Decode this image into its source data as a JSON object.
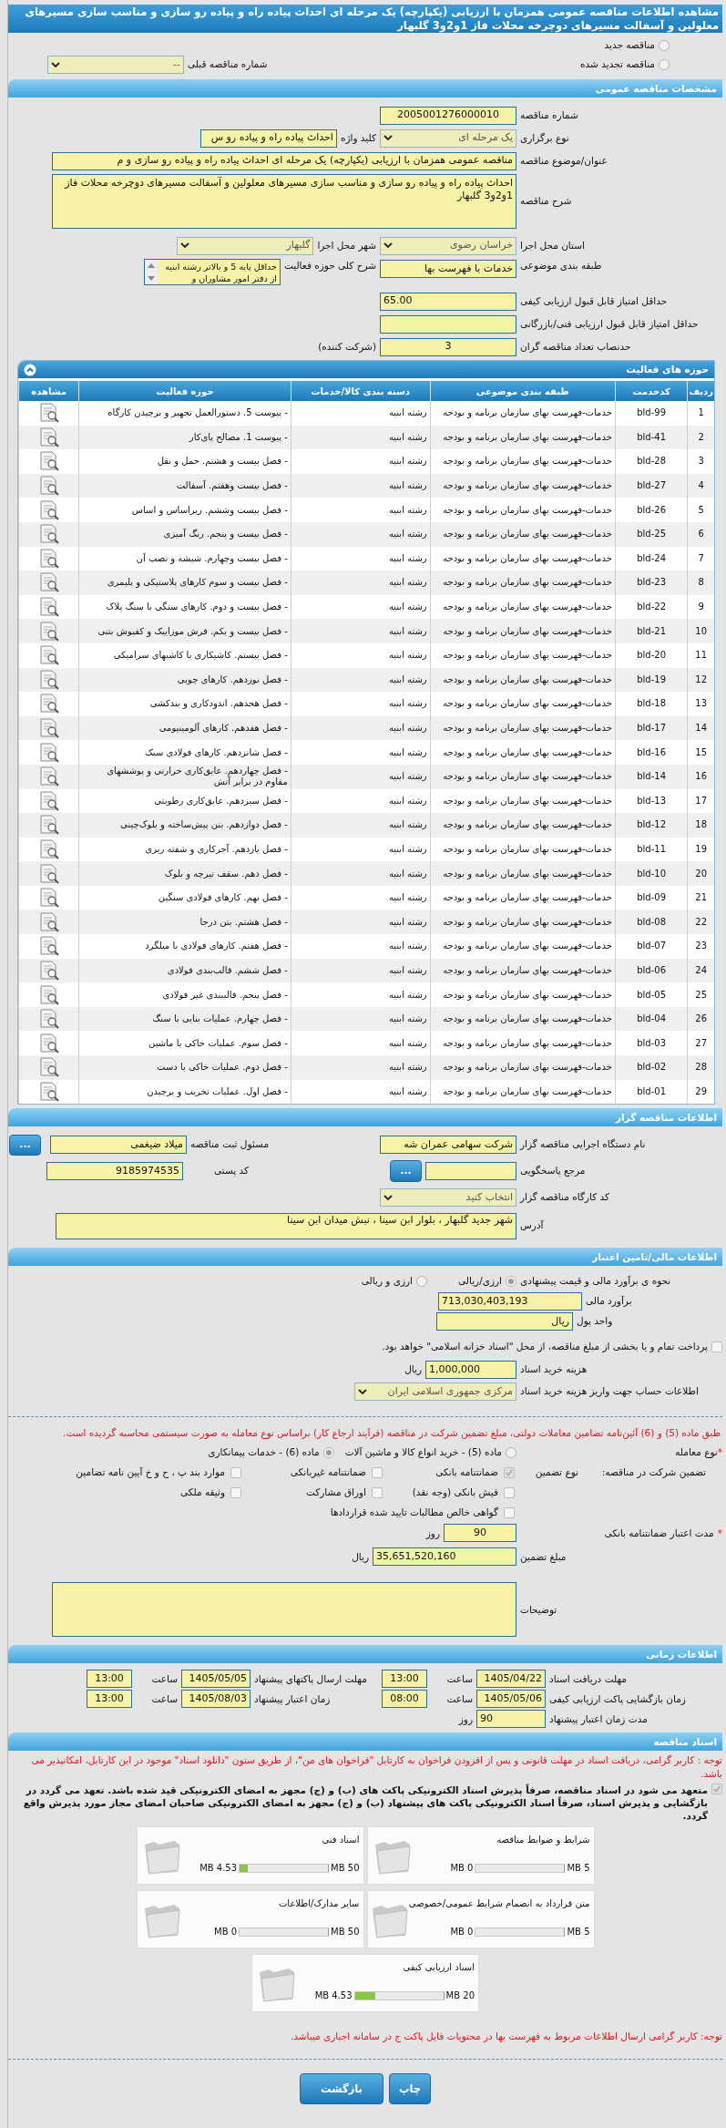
{
  "title": "مشاهده اطلاعات مناقصه عمومی همزمان با ارزیابی (یکپارچه) یک مرحله ای احداث پیاده راه و پیاده رو سازی و مناسب سازی مسیرهای معلولین و آسفالت مسیرهای دوچرخه محلات فاز 1و2و3 گلبهار",
  "tender_kind": [
    {
      "label": "مناقصه جدید",
      "selected": false
    },
    {
      "label": "مناقصه تجدید شده",
      "selected": false
    }
  ],
  "previous_tender": {
    "label": "شماره مناقصه قبلی",
    "value": "--"
  },
  "general": {
    "heading": "مشخصات مناقصه عمومی",
    "number": {
      "label": "شماره مناقصه",
      "value": "2005001276000010"
    },
    "holding_type": {
      "label": "نوع برگزاری",
      "value": "یک مرحله ای"
    },
    "keyword": {
      "label": "کلید واژه",
      "value": "احداث پیاده راه و پیاده رو س"
    },
    "subject": {
      "label": "عنوان/موضوع مناقصه",
      "value": "مناقصه عمومی همزمان با ارزیابی (یکپارچه) یک مرحله ای احداث پیاده راه و پیاده رو سازی و م"
    },
    "description": {
      "label": "شرح مناقصه",
      "value": "احداث پیاده راه و پیاده رو سازی و مناسب سازی مسیرهای معلولین و آسفالت مسیرهای دوچرخه محلات فاز 1و2و3 گلبهار"
    },
    "province": {
      "label": "استان محل اجرا",
      "value": "خراسان رضوی"
    },
    "city": {
      "label": "شهر محل اجرا",
      "value": "گلبهار"
    },
    "category": {
      "label": "طبقه بندی موضوعی",
      "value": "خدمات با فهرست بها"
    },
    "activity_scope": {
      "label": "شرح کلی حوزه فعالیت",
      "value": "حداقل پایه 5 و بالاتر رشته ابنیه از دفتر امور مشاوران و"
    },
    "min_quality_score": {
      "label": "حداقل امتیاز قابل قبول ارزیابی کیفی",
      "value": "65.00"
    },
    "min_technical_score": {
      "label": "حداقل امتیاز قابل قبول ارزیابی فنی/بازرگانی"
    },
    "quorum": {
      "label": "حدنصاب تعداد مناقصه گران",
      "value": "3",
      "suffix": "(شرکت کننده)"
    }
  },
  "activities": {
    "heading": "حوزه های فعالیت",
    "columns": [
      "ردیف",
      "کدخدمت",
      "طبقه بندی موضوعی",
      "دسته بندی کالا/خدمات",
      "حوزه فعالیت",
      "مشاهده"
    ],
    "rows": [
      {
        "cells": [
          "1",
          "bld-99",
          "خدمات-فهرست بهای سازمان برنامه و بودجه",
          "رشته ابنیه",
          "- پیوست 5. دستورالعمل تجهیز و برچیدن کارگاه"
        ]
      },
      {
        "cells": [
          "2",
          "bld-41",
          "خدمات-فهرست بهای سازمان برنامه و بودجه",
          "رشته ابنیه",
          "- پیوست 1. مصالح پای‌کار"
        ]
      },
      {
        "cells": [
          "3",
          "bld-28",
          "خدمات-فهرست بهای سازمان برنامه و بودجه",
          "رشته ابنیه",
          "- فصل بیست و هشتم. حمل و نقل"
        ]
      },
      {
        "cells": [
          "4",
          "bld-27",
          "خدمات-فهرست بهای سازمان برنامه و بودجه",
          "رشته ابنیه",
          "- فصل بیست وهفتم. آسفالت"
        ]
      },
      {
        "cells": [
          "5",
          "bld-26",
          "خدمات-فهرست بهای سازمان برنامه و بودجه",
          "رشته ابنیه",
          "- فصل بیست وششم. زیراساس و اساس"
        ]
      },
      {
        "cells": [
          "6",
          "bld-25",
          "خدمات-فهرست بهای سازمان برنامه و بودجه",
          "رشته ابنیه",
          "- فصل بیست و پنجم. رنگ آمیزی"
        ]
      },
      {
        "cells": [
          "7",
          "bld-24",
          "خدمات-فهرست بهای سازمان برنامه و بودجه",
          "رشته ابنیه",
          "- فصل بیست وچهارم. شیشه و نصب آن"
        ]
      },
      {
        "cells": [
          "8",
          "bld-23",
          "خدمات-فهرست بهای سازمان برنامه و بودجه",
          "رشته ابنیه",
          "- فصل بیست و سوم کارهای پلاستیکی و پلیمری"
        ]
      },
      {
        "cells": [
          "9",
          "bld-22",
          "خدمات-فهرست بهای سازمان برنامه و بودجه",
          "رشته ابنیه",
          "- فصل بیست و دوم. کارهای سنگی با سنگ پلاک"
        ]
      },
      {
        "cells": [
          "10",
          "bld-21",
          "خدمات-فهرست بهای سازمان برنامه و بودجه",
          "رشته ابنیه",
          "- فصل بیست و یکم. فرش موزاییک و کفپوش بتنی"
        ]
      },
      {
        "cells": [
          "11",
          "bld-20",
          "خدمات-فهرست بهای سازمان برنامه و بودجه",
          "رشته ابنیه",
          "- فصل بیستم. کاشیکاری با کاشیهای سرامیکی"
        ]
      },
      {
        "cells": [
          "12",
          "bld-19",
          "خدمات-فهرست بهای سازمان برنامه و بودجه",
          "رشته ابنیه",
          "- فصل نوزدهم. کارهای چوبی"
        ]
      },
      {
        "cells": [
          "13",
          "bld-18",
          "خدمات-فهرست بهای سازمان برنامه و بودجه",
          "رشته ابنیه",
          "- فصل هجدهم. اندودکاری و بندکشی"
        ]
      },
      {
        "cells": [
          "14",
          "bld-17",
          "خدمات-فهرست بهای سازمان برنامه و بودجه",
          "رشته ابنیه",
          "- فصل هفدهم. کارهای آلومینیومی"
        ]
      },
      {
        "cells": [
          "15",
          "bld-16",
          "خدمات-فهرست بهای سازمان برنامه و بودجه",
          "رشته ابنیه",
          "- فصل شانزدهم. کارهای فولادی سبک"
        ]
      },
      {
        "cells": [
          "16",
          "bld-14",
          "خدمات-فهرست بهای سازمان برنامه و بودجه",
          "رشته ابنیه",
          "- فصل چهاردهم. عایق‌کاری حرارتی و پوششهای مقاوم در برابر آتش"
        ]
      },
      {
        "cells": [
          "17",
          "bld-13",
          "خدمات-فهرست بهای سازمان برنامه و بودجه",
          "رشته ابنیه",
          "- فصل سیزدهم. عایق‌کاری رطوبتی"
        ]
      },
      {
        "cells": [
          "18",
          "bld-12",
          "خدمات-فهرست بهای سازمان برنامه و بودجه",
          "رشته ابنیه",
          "- فصل دوازدهم. بتن پیش‌ساخته و بلوک‌چینی"
        ]
      },
      {
        "cells": [
          "19",
          "bld-11",
          "خدمات-فهرست بهای سازمان برنامه و بودجه",
          "رشته ابنیه",
          "- فصل یازدهم. آجرکاری و شفته ریزی"
        ]
      },
      {
        "cells": [
          "20",
          "bld-10",
          "خدمات-فهرست بهای سازمان برنامه و بودجه",
          "رشته ابنیه",
          "- فصل دهم. سقف تیرچه و بلوک"
        ]
      },
      {
        "cells": [
          "21",
          "bld-09",
          "خدمات-فهرست بهای سازمان برنامه و بودجه",
          "رشته ابنیه",
          "- فصل نهم. کارهای فولادی سنگین"
        ]
      },
      {
        "cells": [
          "22",
          "bld-08",
          "خدمات-فهرست بهای سازمان برنامه و بودجه",
          "رشته ابنیه",
          "- فصل هشتم. بتن درجا"
        ]
      },
      {
        "cells": [
          "23",
          "bld-07",
          "خدمات-فهرست بهای سازمان برنامه و بودجه",
          "رشته ابنیه",
          "- فصل هفتم. کارهای فولادی با میلگرد"
        ]
      },
      {
        "cells": [
          "24",
          "bld-06",
          "خدمات-فهرست بهای سازمان برنامه و بودجه",
          "رشته ابنیه",
          "- فصل ششم. قالب‌بندی فولادی"
        ]
      },
      {
        "cells": [
          "25",
          "bld-05",
          "خدمات-فهرست بهای سازمان برنامه و بودجه",
          "رشته ابنیه",
          "- فصل پنجم. قالببندی غیر فولادی"
        ]
      },
      {
        "cells": [
          "26",
          "bld-04",
          "خدمات-فهرست بهای سازمان برنامه و بودجه",
          "رشته ابنیه",
          "- فصل چهارم. عملیات بنایی با سنگ"
        ]
      },
      {
        "cells": [
          "27",
          "bld-03",
          "خدمات-فهرست بهای سازمان برنامه و بودجه",
          "رشته ابنیه",
          "- فصل سوم. عملیات خاکی با ماشین"
        ]
      },
      {
        "cells": [
          "28",
          "bld-02",
          "خدمات-فهرست بهای سازمان برنامه و بودجه",
          "رشته ابنیه",
          "- فصل دوم. عملیات خاکی با دست"
        ]
      },
      {
        "cells": [
          "29",
          "bld-01",
          "خدمات-فهرست بهای سازمان برنامه و بودجه",
          "رشته ابنیه",
          "- فصل اول. عملیات تخریب و برچیدن"
        ]
      }
    ]
  },
  "organizer": {
    "heading": "اطلاعات مناقصه گزار",
    "agency": {
      "label": "نام دستگاه اجرایی مناقصه گزار",
      "value": "شرکت سهامی عمران شه"
    },
    "registrar": {
      "label": "مسئول ثبت مناقصه",
      "value": "میلاد ضیغمی",
      "button": "..."
    },
    "reference": {
      "label": "مرجع پاسخگویی",
      "button": "..."
    },
    "postal_code": {
      "label": "کد پستی",
      "value": "9185974535"
    },
    "workshop_code": {
      "label": "کد کارگاه مناقصه گزار",
      "value": "انتخاب کنید"
    },
    "address": {
      "label": "آدرس",
      "value": "شهر جدید گلبهار ، بلوار ابن سینا ، نبش میدان ابن سینا"
    }
  },
  "financial": {
    "heading": "اطلاعات مالی/تامین اعتبار",
    "estimate_method": {
      "label": "نحوه ی برآورد مالی و قیمت پیشنهادی",
      "options": [
        {
          "label": "ارزی/ریالی",
          "selected": true
        },
        {
          "label": "ارزی و ریالی",
          "selected": false
        }
      ]
    },
    "estimate": {
      "label": "برآورد مالی",
      "value": "713,030,403,193"
    },
    "currency": {
      "label": "واحد پول",
      "value": "ریال"
    },
    "treasury_bonds": {
      "label": "پرداخت تمام و یا بخشی از مبلغ مناقصه، از محل \"اسناد خزانه اسلامی\" خواهد بود.",
      "checked": false
    },
    "document_fee": {
      "label": "هزینه خرید اسناد",
      "value": "1,000,000",
      "unit": "ریال"
    },
    "account": {
      "label": "اطلاعات حساب جهت واریز هزینه خرید اسناد",
      "value": "مرکزی جمهوری اسلامی ایران"
    },
    "notice": "طبق ماده (5) و (6) آئین‌نامه تضامین معاملات دولتی، مبلغ تضمین شرکت در مناقصه (فرآیند ارجاع کار) براساس نوع معامله به صورت سیستمی محاسبه گردیده است.",
    "deal_type": {
      "required_mark": "*",
      "label": "نوع معامله",
      "options": [
        {
          "label": "ماده (5) - خرید انواع کالا و ماشین آلات",
          "selected": false
        },
        {
          "label": "ماده (6) - خدمات پیمانکاری",
          "selected": true
        }
      ]
    },
    "guarantee": {
      "label": "تضمین شرکت در مناقصه:",
      "type_label": "نوع تضمین",
      "options": [
        {
          "label": "ضمانتنامه بانکی",
          "checked": true
        },
        {
          "label": "ضمانتنامه غیربانکی",
          "checked": false
        },
        {
          "label": "موارد بند پ ، ح و خ آیین نامه تضامین",
          "checked": false
        },
        {
          "label": "فیش بانکی (وجه نقد)",
          "checked": false
        },
        {
          "label": "اوراق مشارکت",
          "checked": false
        },
        {
          "label": "وثیقه ملکی",
          "checked": false
        },
        {
          "label": "گواهی خالص مطالبات تایید شده قراردادها",
          "checked": false
        }
      ]
    },
    "guarantee_validity": {
      "required_mark": "*",
      "label": "مدت اعتبار ضمانتنامه بانکی",
      "value": "90",
      "unit": "روز"
    },
    "guarantee_amount": {
      "label": "مبلغ تضمین",
      "value": "35,651,520,160",
      "unit": "ریال"
    },
    "notes": {
      "label": "توضیحات"
    }
  },
  "schedule": {
    "heading": "اطلاعات زمانی",
    "rows": [
      [
        {
          "label": "مهلت دریافت اسناد",
          "date": "1405/04/22",
          "time_label": "ساعت",
          "time": "13:00"
        },
        {
          "label": "مهلت ارسال پاکتهای پیشنهاد",
          "date": "1405/05/05",
          "time_label": "ساعت",
          "time": "13:00"
        }
      ],
      [
        {
          "label": "زمان بازگشایی پاکت ارزیابی کیفی",
          "date": "1405/05/06",
          "time_label": "ساعت",
          "time": "08:00"
        },
        {
          "label": "زمان اعتبار پیشنهاد",
          "date": "1405/08/03",
          "time_label": "ساعت",
          "time": "13:00"
        }
      ]
    ],
    "validity": {
      "label": "مدت زمان اعتبار پیشنهاد",
      "value": "90",
      "unit": "روز"
    }
  },
  "documents": {
    "heading": "اسناد مناقصه",
    "notice": "توجه : کاربر گرامی، دریافت اسناد در مهلت قانونی و پس از افزودن فراخوان به کارتابل \"فراخوان های من\"، از طریق ستون \"دانلود اسناد\" موجود در این کارتابل، امکانپذیر می باشد.",
    "commitment": {
      "text": "متعهد می شود در اسناد مناقصه، صرفاً پذیرش اسناد الکترونیکی پاکت های (ب) و (ج) مجهز به امضای الکترونیکی قید شده باشد. تعهد می گردد در بازگشایی و پذیرش اسناد، صرفاً اسناد الکترونیکی پاکت های پیشنهاد (ب) و (ج) مجهز به امضای الکترونیکی صاحبان امضای مجاز مورد پذیرش واقع گردد.",
      "checked": true
    },
    "files": [
      {
        "name": "شرایط و ضوابط مناقصه",
        "used": "0 MB",
        "max": "5 MB",
        "level": 0
      },
      {
        "name": "اسناد فنی",
        "used": "4.53 MB",
        "max": "50 MB",
        "level": 0.09
      },
      {
        "name": "متن قرارداد به انضمام شرایط عمومی/خصوصی",
        "used": "0 MB",
        "max": "5 MB",
        "level": 0
      },
      {
        "name": "سایر مدارک/اطلاعات",
        "used": "0 MB",
        "max": "50 MB",
        "level": 0
      },
      {
        "name": "اسناد ارزیابی کیفی",
        "used": "4.53 MB",
        "max": "20 MB",
        "level": 0.23
      }
    ],
    "footer_notice": "توجه: کاربر گرامی ارسال اطلاعات مربوط به فهرست بها در محتویات فایل پاکت ج در سامانه اجباری میباشد."
  },
  "buttons": [
    "چاپ",
    "بازگشت"
  ]
}
